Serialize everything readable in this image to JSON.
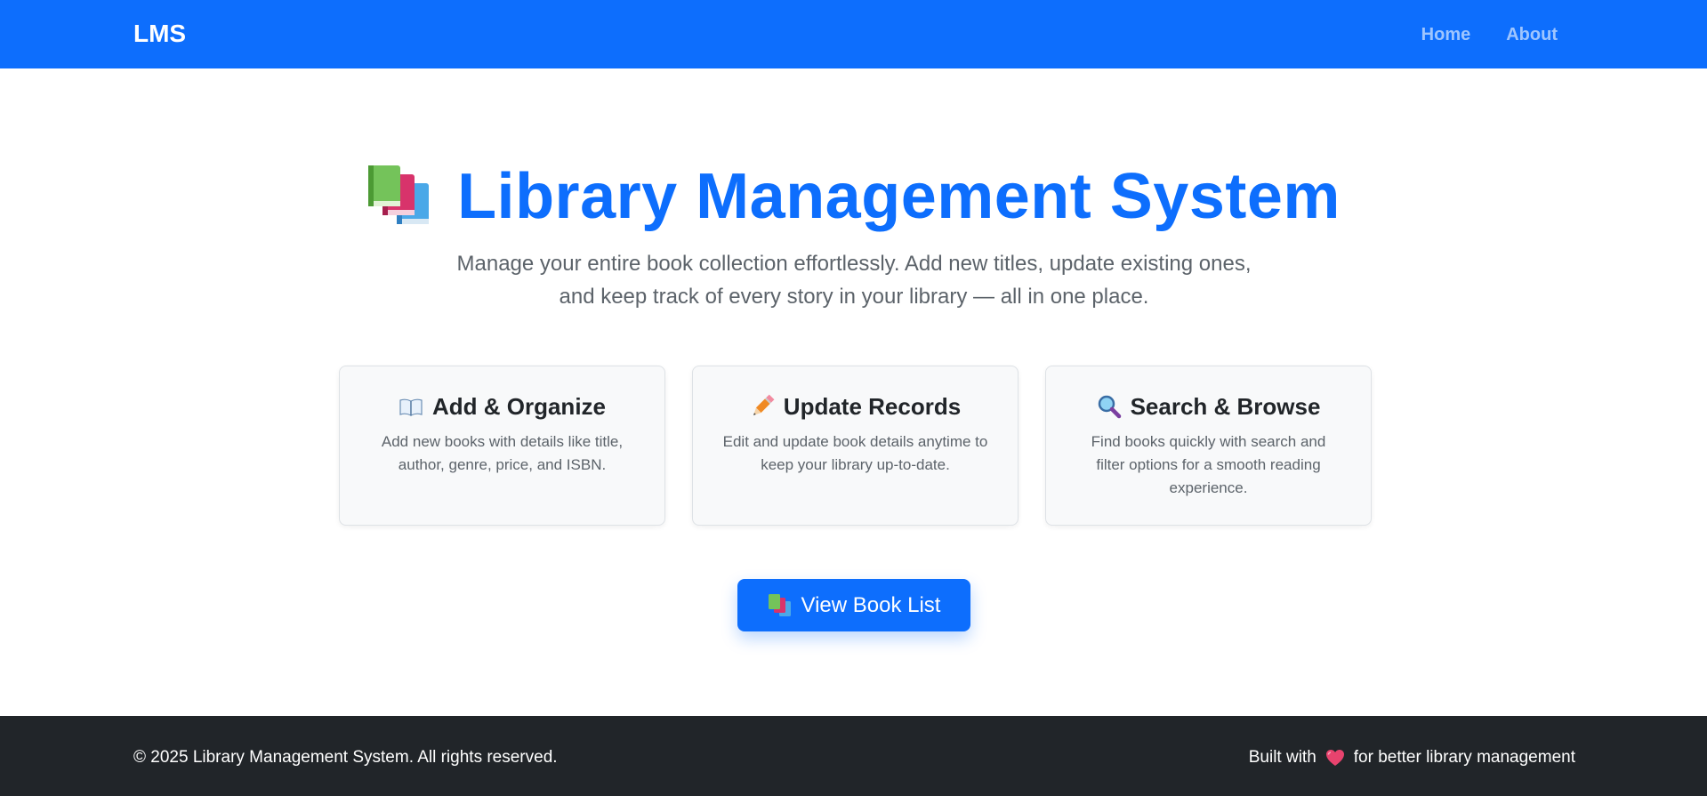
{
  "navbar": {
    "brand": "LMS",
    "links": [
      "Home",
      "About"
    ],
    "bg_color": "#0d6efd"
  },
  "hero": {
    "icon": "books-icon",
    "title": "Library Management System",
    "subtitle": "Manage your entire book collection effortlessly. Add new titles, update existing ones, and keep track of every story in your library — all in one place."
  },
  "cards": [
    {
      "icon": "open-book-icon",
      "title": "Add & Organize",
      "text": "Add new books with details like title, author, genre, price, and ISBN."
    },
    {
      "icon": "pencil-icon",
      "title": "Update Records",
      "text": "Edit and update book details anytime to keep your library up-to-date."
    },
    {
      "icon": "magnifier-icon",
      "title": "Search & Browse",
      "text": "Find books quickly with search and filter options for a smooth reading experience."
    }
  ],
  "cta": {
    "icon": "books-icon",
    "label": "View Book List"
  },
  "footer": {
    "copyright": "© 2025 Library Management System. All rights reserved.",
    "built_prefix": "Built with",
    "built_icon": "heart-icon",
    "built_suffix": "for better library management",
    "bg_color": "#212529"
  }
}
